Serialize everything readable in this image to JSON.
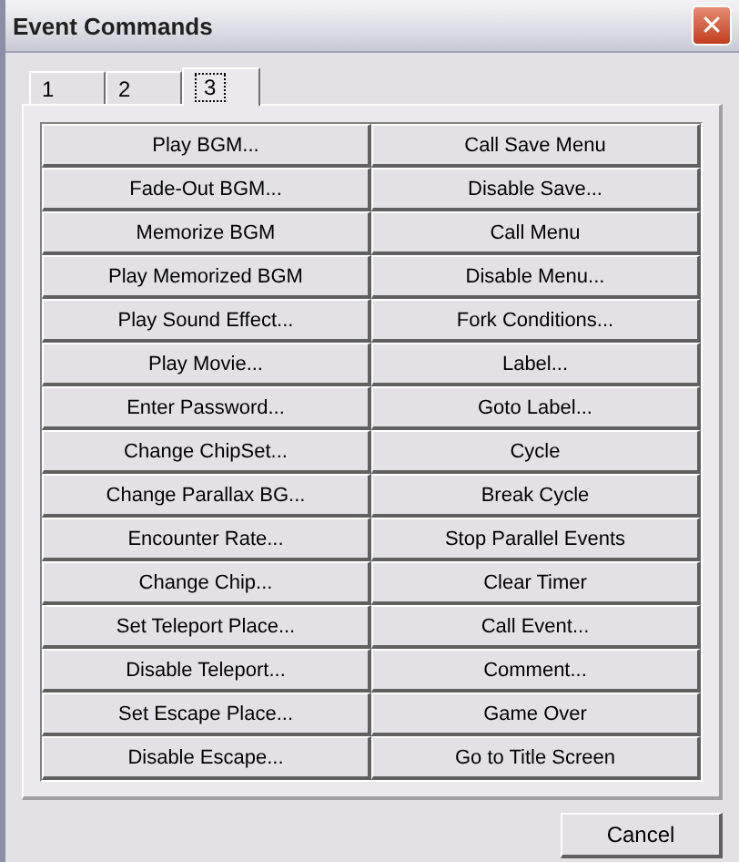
{
  "window": {
    "title": "Event Commands",
    "close": "✕"
  },
  "tabs": [
    {
      "label": "1",
      "selected": false
    },
    {
      "label": "2",
      "selected": false
    },
    {
      "label": "3",
      "selected": true
    }
  ],
  "commands": [
    [
      "Play BGM...",
      "Call Save Menu"
    ],
    [
      "Fade-Out BGM...",
      "Disable Save..."
    ],
    [
      "Memorize BGM",
      "Call Menu"
    ],
    [
      "Play Memorized BGM",
      "Disable Menu..."
    ],
    [
      "Play Sound Effect...",
      "Fork Conditions..."
    ],
    [
      "Play Movie...",
      "Label..."
    ],
    [
      "Enter Password...",
      "Goto Label..."
    ],
    [
      "Change ChipSet...",
      "Cycle"
    ],
    [
      "Change Parallax BG...",
      "Break Cycle"
    ],
    [
      "Encounter Rate...",
      "Stop Parallel Events"
    ],
    [
      "Change Chip...",
      "Clear Timer"
    ],
    [
      "Set Teleport Place...",
      "Call Event..."
    ],
    [
      "Disable Teleport...",
      "Comment..."
    ],
    [
      "Set Escape Place...",
      "Game Over"
    ],
    [
      "Disable Escape...",
      "Go to Title Screen"
    ]
  ],
  "buttons": [
    "Cancel"
  ]
}
